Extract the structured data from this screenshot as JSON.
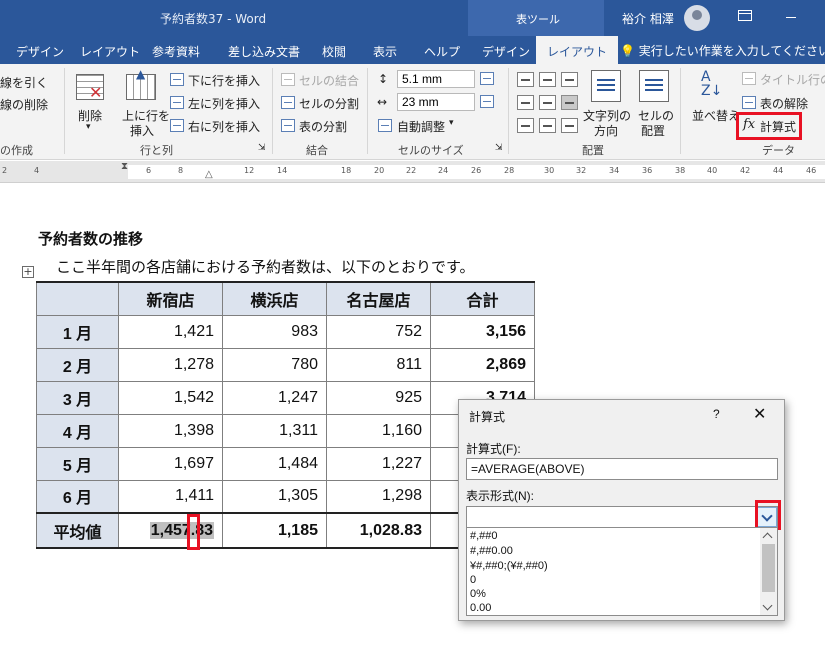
{
  "window": {
    "title": "予約者数37 - Word",
    "context_tool": "表ツール",
    "user": "裕介 相澤"
  },
  "tabs": [
    "デザイン",
    "レイアウト",
    "参考資料",
    "差し込み文書",
    "校閲",
    "表示",
    "ヘルプ",
    "デザイン",
    "レイアウト"
  ],
  "active_tab": "レイアウト",
  "tell_me": "実行したい作業を入力してください",
  "ribbon": {
    "draw": {
      "draw_borders": "線を引く",
      "eraser": "線の削除",
      "label": "の作成"
    },
    "rows_cols": {
      "delete": "削除",
      "insert_above_1": "上に行を",
      "insert_above_2": "挿入",
      "insert_below": "下に行を挿入",
      "insert_left": "左に列を挿入",
      "insert_right": "右に列を挿入",
      "label": "行と列"
    },
    "merge": {
      "merge_cells": "セルの結合",
      "split_cells": "セルの分割",
      "split_table": "表の分割",
      "label": "結合"
    },
    "cell_size": {
      "height": "5.1 mm",
      "width": "23 mm",
      "autofit": "自動調整",
      "label": "セルのサイズ"
    },
    "alignment": {
      "text_dir_1": "文字列の",
      "text_dir_2": "方向",
      "margins_1": "セルの",
      "margins_2": "配置",
      "label": "配置"
    },
    "data": {
      "sort": "並べ替え",
      "repeat_header": "タイトル行の繰",
      "convert": "表の解除",
      "formula_icon": "fx",
      "formula": "計算式",
      "label": "データ"
    }
  },
  "ruler": [
    "2",
    "4",
    "6",
    "8",
    "12",
    "14",
    "18",
    "20",
    "22",
    "24",
    "26",
    "28",
    "30",
    "32",
    "34",
    "36",
    "38",
    "40",
    "42",
    "44",
    "46"
  ],
  "document": {
    "heading": "予約者数の推移",
    "intro": "ここ半年間の各店舗における予約者数は、以下のとおりです。",
    "table": {
      "headers": [
        "",
        "新宿店",
        "横浜店",
        "名古屋店",
        "合計"
      ],
      "rows": [
        [
          "1 月",
          "1,421",
          "983",
          "752",
          "3,156"
        ],
        [
          "2 月",
          "1,278",
          "780",
          "811",
          "2,869"
        ],
        [
          "3 月",
          "1,542",
          "1,247",
          "925",
          "3,714"
        ],
        [
          "4 月",
          "1,398",
          "1,311",
          "1,160",
          ""
        ],
        [
          "5 月",
          "1,697",
          "1,484",
          "1,227",
          ""
        ],
        [
          "6 月",
          "1,411",
          "1,305",
          "1,298",
          ""
        ]
      ],
      "footer": [
        "平均値",
        "1,457.83",
        "1,185",
        "1,028.83",
        ""
      ]
    }
  },
  "dialog": {
    "title": "計算式",
    "help": "?",
    "close": "✕",
    "formula_label": "計算式(F):",
    "formula_value": "=AVERAGE(ABOVE)",
    "format_label": "表示形式(N):",
    "format_value": "",
    "format_options": [
      "#,##0",
      "#,##0.00",
      "¥#,##0;(¥#,##0)",
      "0",
      "0%",
      "0.00"
    ]
  },
  "colors": {
    "accent": "#2b579a",
    "highlight": "#e81123",
    "table_header": "#dce3ee"
  }
}
